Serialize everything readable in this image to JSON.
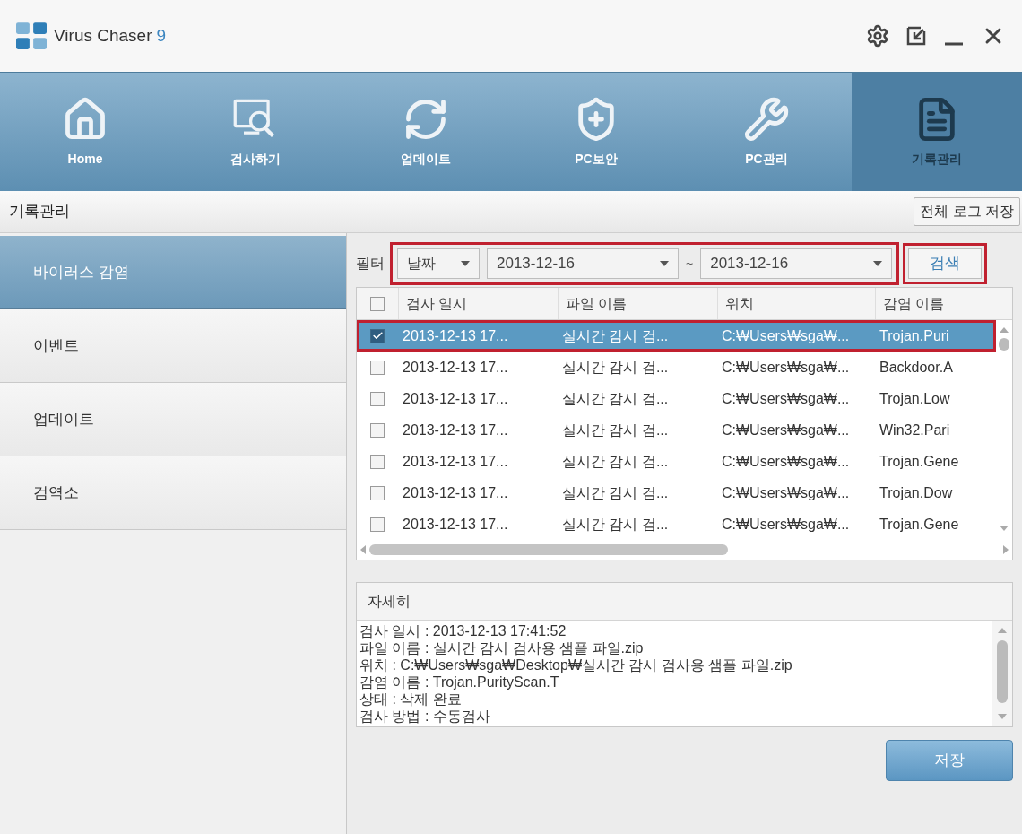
{
  "window": {
    "title": "Virus Chaser",
    "version": "9"
  },
  "nav": [
    {
      "label": "Home",
      "kind": "home",
      "selected": false
    },
    {
      "label": "검사하기",
      "kind": "scan",
      "selected": false
    },
    {
      "label": "업데이트",
      "kind": "update",
      "selected": false
    },
    {
      "label": "PC보안",
      "kind": "shield",
      "selected": false
    },
    {
      "label": "PC관리",
      "kind": "wrench",
      "selected": false
    },
    {
      "label": "기록관리",
      "kind": "document",
      "selected": true
    }
  ],
  "page_title": "기록관리",
  "save_all_log_button": "전체 로그 저장",
  "sidebar": {
    "items": [
      {
        "label": "바이러스 감염",
        "selected": true
      },
      {
        "label": "이벤트",
        "selected": false
      },
      {
        "label": "업데이트",
        "selected": false
      },
      {
        "label": "검역소",
        "selected": false
      }
    ]
  },
  "filter": {
    "label": "필터",
    "type": "날짜",
    "from": "2013-12-16",
    "separator": "~",
    "to": "2013-12-16",
    "highlighted": true
  },
  "search_button": {
    "label": "검색",
    "highlighted": true
  },
  "table": {
    "select_all_checked": false,
    "columns": [
      "검사 일시",
      "파일 이름",
      "위치",
      "감염 이름"
    ],
    "rows": [
      {
        "checked": true,
        "selected": true,
        "highlighted": true,
        "cells": [
          "2013-12-13 17...",
          "실시간 감시 검...",
          "C:₩Users₩sga₩...",
          "Trojan.Puri"
        ]
      },
      {
        "checked": false,
        "selected": false,
        "highlighted": false,
        "cells": [
          "2013-12-13 17...",
          "실시간 감시 검...",
          "C:₩Users₩sga₩...",
          "Backdoor.A"
        ]
      },
      {
        "checked": false,
        "selected": false,
        "highlighted": false,
        "cells": [
          "2013-12-13 17...",
          "실시간 감시 검...",
          "C:₩Users₩sga₩...",
          "Trojan.Low"
        ]
      },
      {
        "checked": false,
        "selected": false,
        "highlighted": false,
        "cells": [
          "2013-12-13 17...",
          "실시간 감시 검...",
          "C:₩Users₩sga₩...",
          "Win32.Pari"
        ]
      },
      {
        "checked": false,
        "selected": false,
        "highlighted": false,
        "cells": [
          "2013-12-13 17...",
          "실시간 감시 검...",
          "C:₩Users₩sga₩...",
          "Trojan.Gene"
        ]
      },
      {
        "checked": false,
        "selected": false,
        "highlighted": false,
        "cells": [
          "2013-12-13 17...",
          "실시간 감시 검...",
          "C:₩Users₩sga₩...",
          "Trojan.Dow"
        ]
      },
      {
        "checked": false,
        "selected": false,
        "highlighted": false,
        "cells": [
          "2013-12-13 17...",
          "실시간 감시 검...",
          "C:₩Users₩sga₩...",
          "Trojan.Gene"
        ]
      }
    ]
  },
  "details": {
    "title": "자세히",
    "lines": [
      "검사 일시 : 2013-12-13 17:41:52",
      "파일 이름 : 실시간 감시 검사용 샘플 파일.zip",
      "위치 : C:₩Users₩sga₩Desktop₩실시간 감시 검사용 샘플 파일.zip",
      "감염 이름 : Trojan.PurityScan.T",
      "상태 : 삭제 완료",
      "검사 방법 : 수동검사"
    ]
  },
  "save_button": "저장"
}
